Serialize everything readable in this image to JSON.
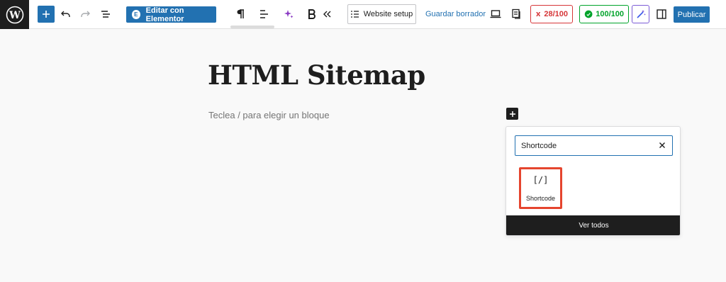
{
  "toolbar": {
    "elementor_label": "Editar con Elementor",
    "website_setup_label": "Website setup",
    "save_draft_label": "Guardar borrador",
    "seo_score": "28/100",
    "readability_score": "100/100",
    "publish_label": "Publicar"
  },
  "editor": {
    "post_title": "HTML Sitemap",
    "block_placeholder": "Teclea / para elegir un bloque"
  },
  "inserter": {
    "search_value": "Shortcode",
    "results": [
      {
        "icon_text": "[/]",
        "label": "Shortcode"
      }
    ],
    "view_all_label": "Ver todos"
  },
  "colors": {
    "accent": "#2271b1",
    "seo_bad": "#d63638",
    "seo_good": "#00a32a",
    "highlight": "#e5452e"
  }
}
